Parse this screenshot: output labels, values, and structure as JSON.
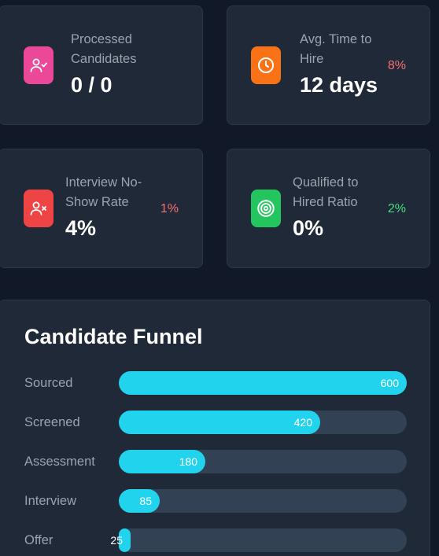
{
  "colors": {
    "background": "#111827",
    "card": "#1f2937",
    "accent": "#22d3ee",
    "negative": "#f87171",
    "positive": "#4ade80"
  },
  "stats": [
    {
      "label_lines": [
        "Processed",
        "Candidates"
      ],
      "value": "0 / 0",
      "change": "",
      "icon": "user-check-icon",
      "icon_color": "#ec4899"
    },
    {
      "label_lines": [
        "Avg. Time to",
        "Hire"
      ],
      "value": "12 days",
      "change": "8%",
      "change_color": "#f87171",
      "icon": "clock-icon",
      "icon_color": "#f97316"
    },
    {
      "label_lines": [
        "Interview No-",
        "Show Rate"
      ],
      "value": "4%",
      "change": "1%",
      "change_color": "#f87171",
      "icon": "user-x-icon",
      "icon_color": "#ef4444"
    },
    {
      "label_lines": [
        "Qualified to",
        "Hired Ratio"
      ],
      "value": "0%",
      "change": "2%",
      "change_color": "#4ade80",
      "icon": "target-icon",
      "icon_color": "#22c55e"
    }
  ],
  "funnel": {
    "title": "Candidate Funnel",
    "max": 600,
    "stages": [
      {
        "label": "Sourced",
        "value": 600
      },
      {
        "label": "Screened",
        "value": 420
      },
      {
        "label": "Assessment",
        "value": 180
      },
      {
        "label": "Interview",
        "value": 85
      },
      {
        "label": "Offer",
        "value": 25
      }
    ]
  }
}
